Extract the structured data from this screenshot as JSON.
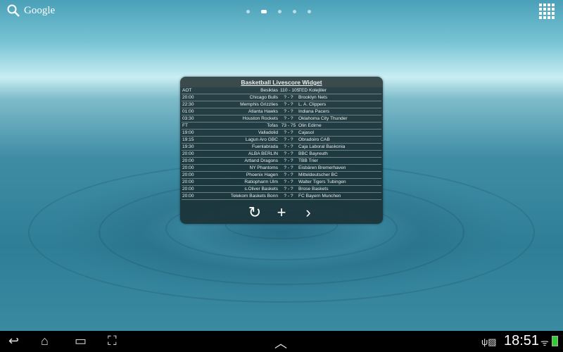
{
  "search": {
    "label": "Google"
  },
  "home_pages": {
    "count": 5,
    "active": 1
  },
  "widget": {
    "title": "Basketball Livescore Widget",
    "games": [
      {
        "time": "AOT",
        "home": "Besiktas",
        "score": "110 - 105",
        "away": "TED Kolejliler"
      },
      {
        "time": "20:00",
        "home": "Chicago Bulls",
        "score": "? - ?",
        "away": "Brooklyn Nets"
      },
      {
        "time": "22:30",
        "home": "Memphis Grizzlies",
        "score": "? - ?",
        "away": "L. A. Clippers"
      },
      {
        "time": "01:00",
        "home": "Atlanta Hawks",
        "score": "? - ?",
        "away": "Indiana Pacers"
      },
      {
        "time": "03:30",
        "home": "Houston Rockets",
        "score": "? - ?",
        "away": "Oklahoma City Thunder"
      },
      {
        "time": "FT",
        "home": "Tofas",
        "score": "73 - 75",
        "away": "Olin Edirne"
      },
      {
        "time": "19:00",
        "home": "Valladolid",
        "score": "? - ?",
        "away": "Cajasol"
      },
      {
        "time": "19:15",
        "home": "Lagun Aro GBC",
        "score": "? - ?",
        "away": "Obradoiro CAB"
      },
      {
        "time": "19:30",
        "home": "Fuenlabrada",
        "score": "? - ?",
        "away": "Caja Laboral Baskonia"
      },
      {
        "time": "20:00",
        "home": "ALBA BERLIN",
        "score": "? - ?",
        "away": "BBC Bayreuth"
      },
      {
        "time": "20:00",
        "home": "Artland Dragons",
        "score": "? - ?",
        "away": "TBB Trier"
      },
      {
        "time": "20:00",
        "home": "NY Phantoms",
        "score": "? - ?",
        "away": "Eisbären Bremerhaven"
      },
      {
        "time": "20:00",
        "home": "Phoenix Hagen",
        "score": "? - ?",
        "away": "Mitteldeutscher BC"
      },
      {
        "time": "20:00",
        "home": "Ratiopharm Ulm",
        "score": "? - ?",
        "away": "Walter Tigers Tubingen"
      },
      {
        "time": "20:00",
        "home": "s.Oliver Baskets",
        "score": "? - ?",
        "away": "Brose Baskets"
      },
      {
        "time": "20:00",
        "home": "Telekom Baskets Bonn",
        "score": "? - ?",
        "away": "FC Bayern Munchen"
      }
    ]
  },
  "status": {
    "time": "18:51"
  }
}
